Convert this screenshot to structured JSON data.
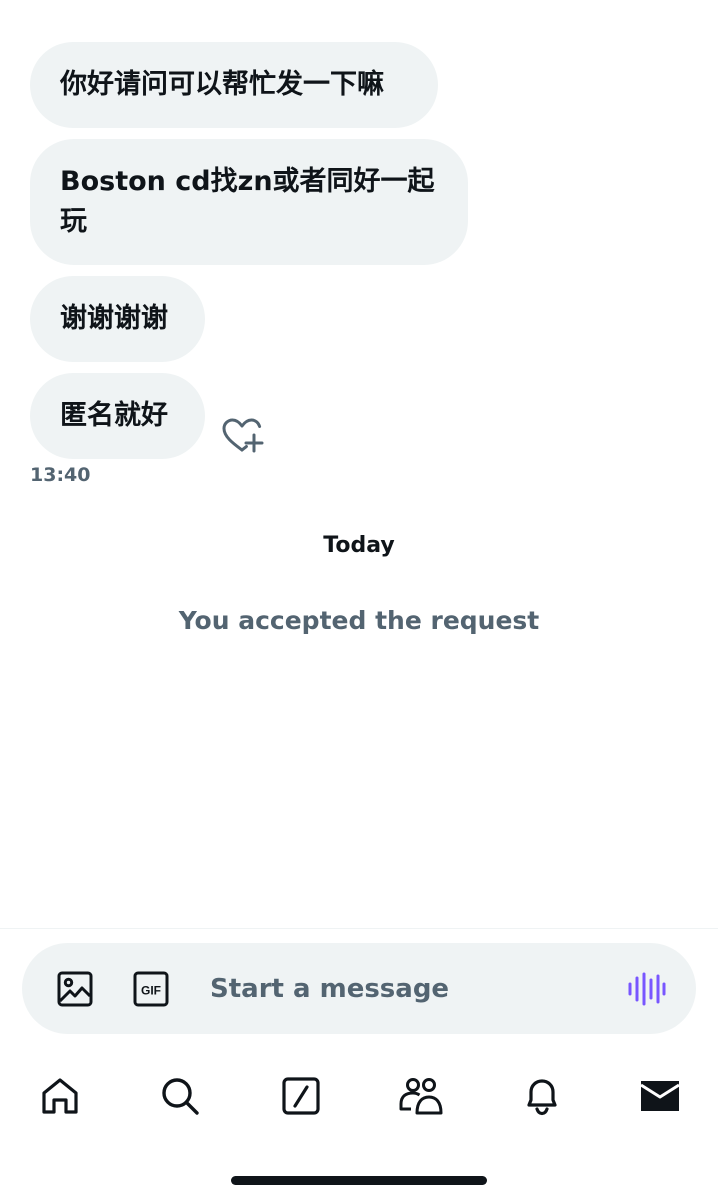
{
  "conversation": {
    "messages": [
      {
        "text": "你好请问可以帮忙发一下嘛"
      },
      {
        "text": "Boston cd找zn或者同好一起玩"
      },
      {
        "text": "谢谢谢谢"
      },
      {
        "text": "匿名就好"
      }
    ],
    "last_message_time": "13:40",
    "reaction_icon": "heart-plus-icon",
    "date_separator": "Today",
    "system_note": "You accepted the request"
  },
  "composer": {
    "placeholder": "Start a message",
    "media_icon": "image-icon",
    "gif_icon": "gif-icon",
    "gif_label": "GIF",
    "voice_icon": "voice-waveform-icon",
    "voice_color": "#7856ff"
  },
  "bottom_nav": {
    "items": [
      {
        "icon": "home-icon"
      },
      {
        "icon": "search-icon"
      },
      {
        "icon": "grok-icon"
      },
      {
        "icon": "communities-icon"
      },
      {
        "icon": "notifications-bell-icon"
      },
      {
        "icon": "messages-envelope-icon",
        "active": true
      }
    ]
  },
  "colors": {
    "bubble_bg": "#eff3f4",
    "text_primary": "#0f1419",
    "text_secondary": "#536471"
  }
}
